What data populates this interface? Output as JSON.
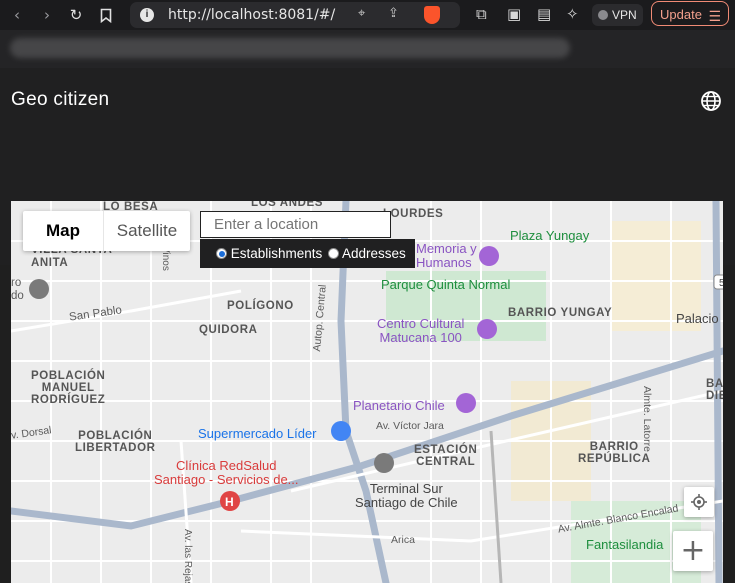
{
  "browser": {
    "url": "http://localhost:8081/#/",
    "vpn_label": "VPN",
    "update_label": "Update",
    "back_icon": "chevron-left-icon",
    "forward_icon": "chevron-right-icon"
  },
  "app": {
    "title": "Geo citizen",
    "language_icon": "globe-icon"
  },
  "map": {
    "type_controls": {
      "map": "Map",
      "satellite": "Satellite"
    },
    "search": {
      "placeholder": "Enter a location"
    },
    "search_types": {
      "establishments": "Establishments",
      "addresses": "Addresses",
      "selected": "establishments"
    },
    "zoom_in": "+",
    "labels": {
      "lo_besa": "LO BESA",
      "los_andes": "LOS ANDES",
      "lourdes": "LOURDES",
      "villa_santa_anita": "VILLA SANTA\nANITA",
      "memoria": "Memoria y\nHumanos",
      "plaza_yungay": "Plaza Yungay",
      "parque_quinta_normal": "Parque Quinta Normal",
      "poligono": "POLÍGONO",
      "quidora": "QUIDORA",
      "san_pablo": "San Pablo",
      "barrio_yungay": "BARRIO YUNGAY",
      "palacio": "Palacio",
      "centro_cultural": "Centro Cultural\nMatucana 100",
      "poblacion_manuel": "POBLACIÓN\nMANUEL\nRODRÍGUEZ",
      "planetario": "Planetario Chile",
      "autop_central": "Autop. Central",
      "av_victor_jara": "Av. Víctor Jara",
      "dorsal": "v. Dorsal",
      "poblacion_libertador": "POBLACIÓN\nLIBERTADOR",
      "supermercado": "Supermercado Líder",
      "estacion_central": "ESTACIÓN\nCENTRAL",
      "barrio_republica": "BARRIO\nREPÚBLICA",
      "almte_latorre": "Almte. Latorre",
      "clinica": "Clínica RedSalud\nSantiago - Servicios de...",
      "terminal_sur": "Terminal Sur\nSantiago de Chile",
      "av_almte_blanco": "Av. Almte. Blanco Encalad",
      "fantasilandia": "Fantasilandia",
      "arica": "Arica",
      "av_las_rejas": "Av. las Rejas",
      "vinos": "Vinos",
      "ro_do": "ro\ndo",
      "ba_die": "BA\nDIE",
      "route_5": "5"
    }
  }
}
